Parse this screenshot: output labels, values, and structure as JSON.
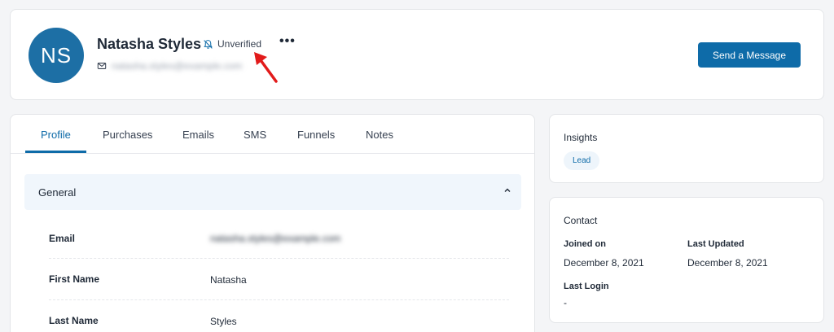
{
  "header": {
    "avatar_initials": "NS",
    "name": "Natasha Styles",
    "status_label": "Unverified",
    "more_label": "•••",
    "email_obscured": "natasha.styles@example.com",
    "send_button_label": "Send a Message",
    "accent_color": "#0e6ba8"
  },
  "tabs": [
    {
      "label": "Profile",
      "active": true
    },
    {
      "label": "Purchases",
      "active": false
    },
    {
      "label": "Emails",
      "active": false
    },
    {
      "label": "SMS",
      "active": false
    },
    {
      "label": "Funnels",
      "active": false
    },
    {
      "label": "Notes",
      "active": false
    }
  ],
  "general": {
    "title": "General",
    "fields": [
      {
        "label": "Email",
        "value": "natasha.styles@example.com",
        "obscured": true
      },
      {
        "label": "First Name",
        "value": "Natasha"
      },
      {
        "label": "Last Name",
        "value": "Styles"
      }
    ]
  },
  "insights": {
    "title": "Insights",
    "badge": "Lead"
  },
  "contact": {
    "title": "Contact",
    "joined_label": "Joined on",
    "joined_value": "December 8, 2021",
    "updated_label": "Last Updated",
    "updated_value": "December 8, 2021",
    "login_label": "Last Login",
    "login_value": "-"
  },
  "icons": {
    "status": "bell-off-icon",
    "email": "envelope-icon",
    "collapse": "chevron-up-icon",
    "annotation": "red-arrow-icon"
  }
}
